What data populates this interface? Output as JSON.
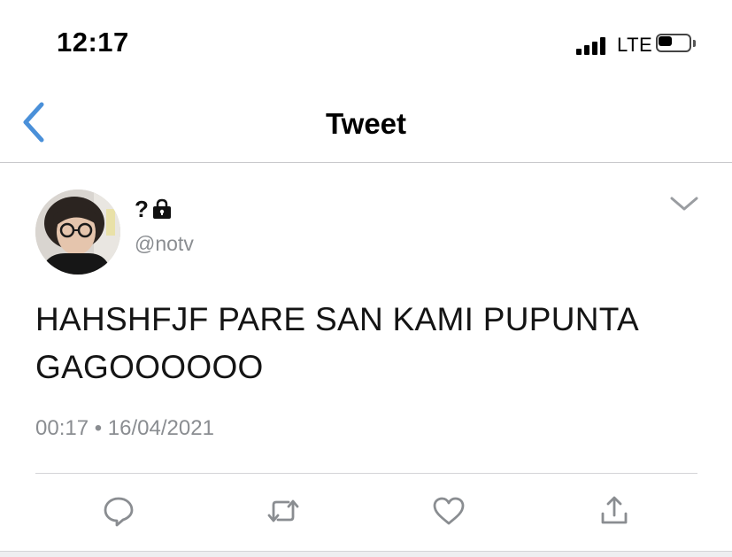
{
  "status_bar": {
    "time": "12:17",
    "network": "LTE",
    "battery_level": 0.45
  },
  "nav": {
    "title": "Tweet",
    "back_icon": "chevron-left-icon"
  },
  "tweet": {
    "display_name": "?",
    "protected_icon": "lock-icon",
    "handle": "@notv",
    "text": "HAHSHFJF PARE SAN KAMI PUPUNTA GAGOOOOOO",
    "timestamp": "00:17 • 16/04/2021",
    "more_icon": "chevron-down-icon"
  },
  "actions": [
    {
      "name": "reply",
      "icon": "reply-icon"
    },
    {
      "name": "retweet",
      "icon": "retweet-icon"
    },
    {
      "name": "like",
      "icon": "heart-icon"
    },
    {
      "name": "share",
      "icon": "share-icon"
    }
  ],
  "colors": {
    "accent": "#4a90d9",
    "icon_gray": "#8a8d91",
    "text": "#141414"
  }
}
